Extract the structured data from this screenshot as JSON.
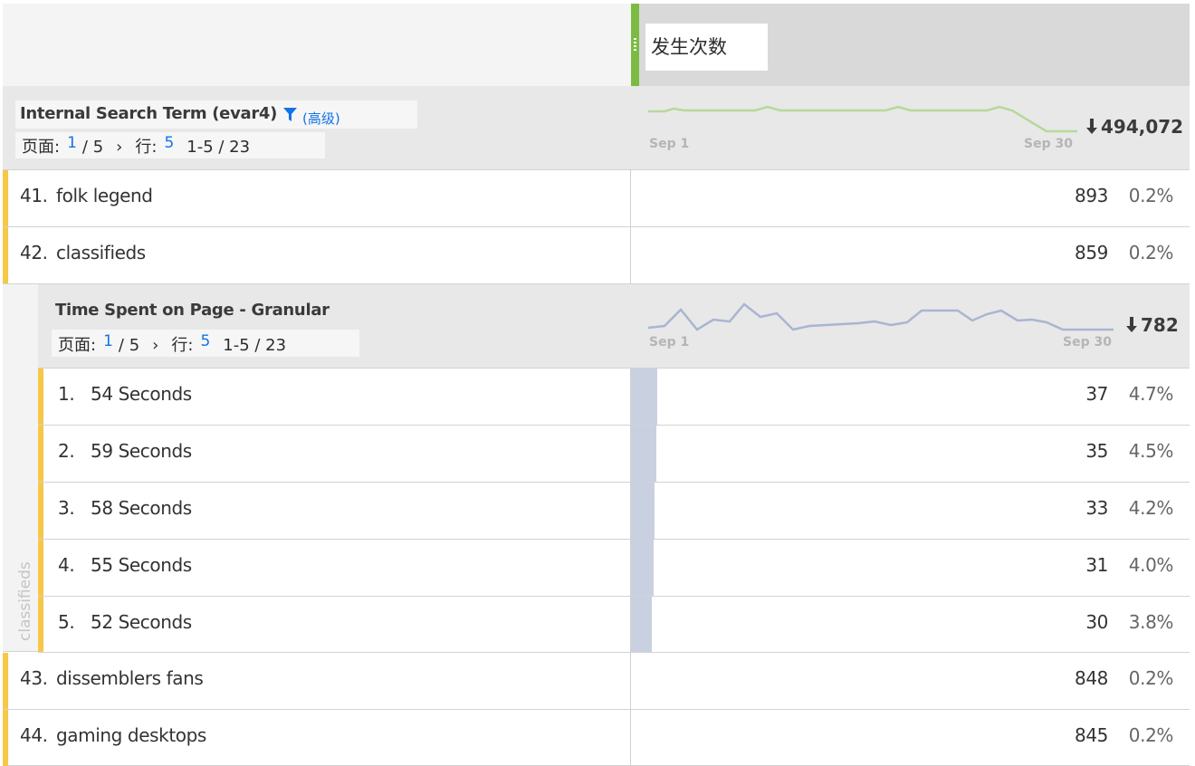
{
  "header": {
    "metric_label": "发生次数"
  },
  "dimension": {
    "title": "Internal Search Term (evar4)",
    "filter_link": "(高级)",
    "pager": {
      "page_label": "页面:",
      "page_current": "1",
      "page_total": "/ 5",
      "next": "›",
      "rows_label": "行:",
      "rows_per_page": "5",
      "range": "1-5 / 23"
    },
    "sparkline": {
      "start_label": "Sep 1",
      "end_label": "Sep 30",
      "color": "#b8d89a"
    },
    "total": "494,072"
  },
  "rows": [
    {
      "index": "41.",
      "label": "folk legend",
      "value": "893",
      "percent": "0.2%"
    },
    {
      "index": "42.",
      "label": "classifieds",
      "value": "859",
      "percent": "0.2%"
    }
  ],
  "nested": {
    "parent_label": "classifieds",
    "title": "Time Spent on Page - Granular",
    "pager": {
      "page_label": "页面:",
      "page_current": "1",
      "page_total": "/ 5",
      "next": "›",
      "rows_label": "行:",
      "rows_per_page": "5",
      "range": "1-5 / 23"
    },
    "sparkline": {
      "start_label": "Sep 1",
      "end_label": "Sep 30",
      "color": "#a9b5d1"
    },
    "total": "782",
    "rows": [
      {
        "index": "1.",
        "label": "54 Seconds",
        "value": "37",
        "percent": "4.7%",
        "fraction": 0.047
      },
      {
        "index": "2.",
        "label": "59 Seconds",
        "value": "35",
        "percent": "4.5%",
        "fraction": 0.045
      },
      {
        "index": "3.",
        "label": "58 Seconds",
        "value": "33",
        "percent": "4.2%",
        "fraction": 0.042
      },
      {
        "index": "4.",
        "label": "55 Seconds",
        "value": "31",
        "percent": "4.0%",
        "fraction": 0.04
      },
      {
        "index": "5.",
        "label": "52 Seconds",
        "value": "30",
        "percent": "3.8%",
        "fraction": 0.038
      }
    ]
  },
  "rows_after": [
    {
      "index": "43.",
      "label": "dissemblers fans",
      "value": "848",
      "percent": "0.2%"
    },
    {
      "index": "44.",
      "label": "gaming desktops",
      "value": "845",
      "percent": "0.2%"
    }
  ],
  "colors": {
    "accent_green": "#7bbb42",
    "row_marker": "#f7c848",
    "link_blue": "#1473e6"
  }
}
